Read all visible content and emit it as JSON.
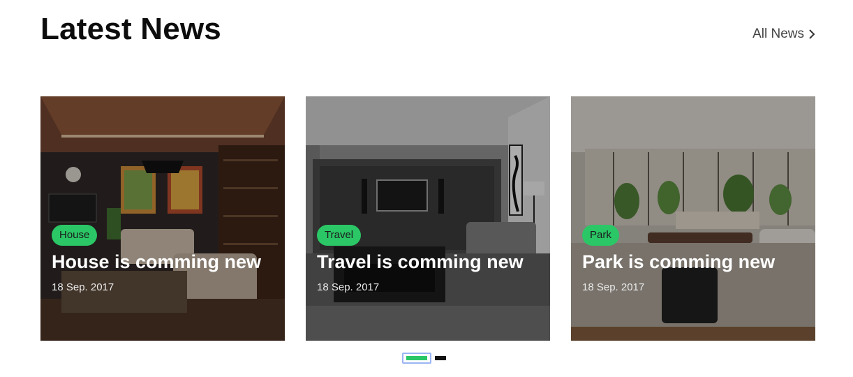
{
  "section": {
    "title": "Latest News",
    "all_news_label": "All News"
  },
  "colors": {
    "accent": "#2bc766",
    "inactive_dot": "#111111"
  },
  "cards": [
    {
      "badge": "House",
      "title": "House is comming new",
      "date": "18 Sep. 2017"
    },
    {
      "badge": "Travel",
      "title": "Travel is comming new",
      "date": "18 Sep. 2017"
    },
    {
      "badge": "Park",
      "title": "Park is comming new",
      "date": "18 Sep. 2017"
    }
  ],
  "pager": {
    "active_index": 0,
    "count": 2
  }
}
